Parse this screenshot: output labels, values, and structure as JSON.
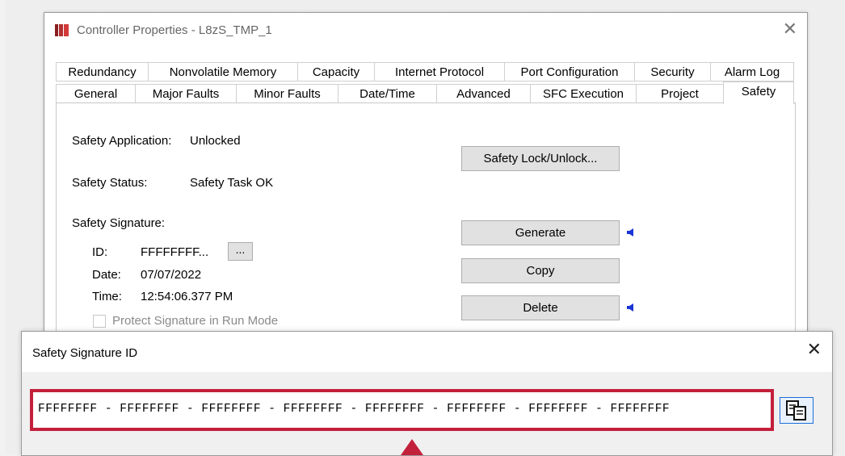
{
  "window": {
    "title": "Controller Properties - L8zS_TMP_1",
    "close_glyph": "✕"
  },
  "tabs_top": [
    "Redundancy",
    "Nonvolatile Memory",
    "Capacity",
    "Internet Protocol",
    "Port Configuration",
    "Security",
    "Alarm Log"
  ],
  "tabs_bottom": [
    "General",
    "Major Faults",
    "Minor Faults",
    "Date/Time",
    "Advanced",
    "SFC Execution",
    "Project",
    "Safety"
  ],
  "selected_tab": "Safety",
  "safety": {
    "app_label": "Safety Application:",
    "app_value": "Unlocked",
    "status_label": "Safety Status:",
    "status_value": "Safety Task OK",
    "signature_label": "Safety Signature:",
    "id_label": "ID:",
    "id_value": "FFFFFFFF...",
    "more_button": "...",
    "date_label": "Date:",
    "date_value": "07/07/2022",
    "time_label": "Time:",
    "time_value": "12:54:06.377 PM",
    "protect_label": "Protect Signature in Run Mode",
    "lock_button": "Safety Lock/Unlock...",
    "generate_button": "Generate",
    "copy_button": "Copy",
    "delete_button": "Delete"
  },
  "dialog": {
    "title": "Safety Signature ID",
    "close_glyph": "✕",
    "signature": "FFFFFFFF - FFFFFFFF - FFFFFFFF - FFFFFFFF - FFFFFFFF - FFFFFFFF - FFFFFFFF - FFFFFFFF"
  },
  "colors": {
    "highlight": "#c3203c",
    "arrow": "#1a34d6"
  }
}
